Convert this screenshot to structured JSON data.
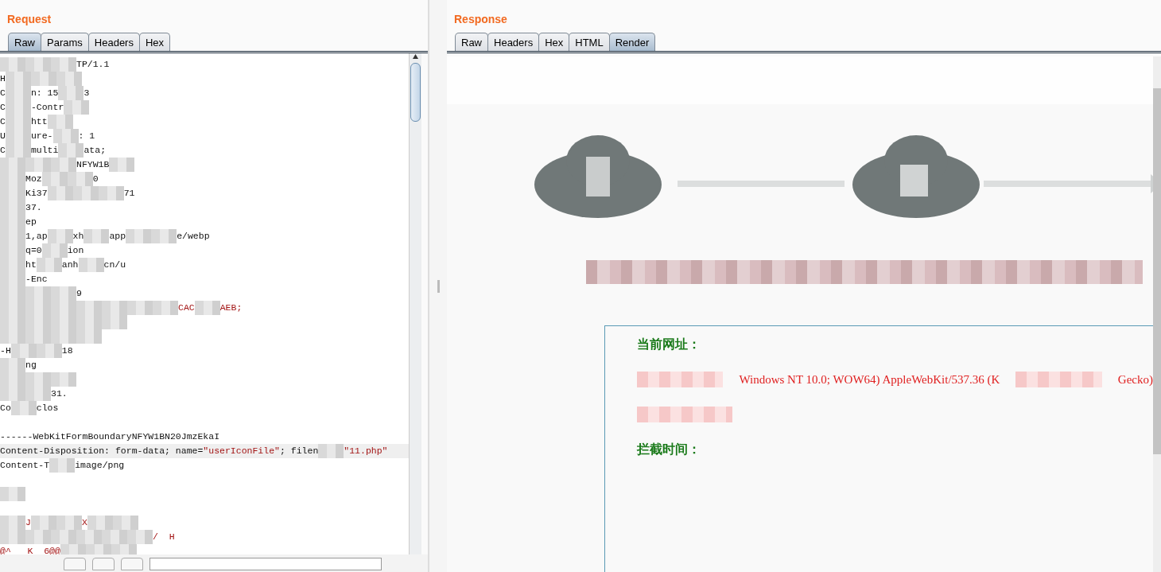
{
  "request": {
    "title": "Request",
    "tabs": [
      {
        "label": "Raw",
        "selected": true
      },
      {
        "label": "Params",
        "selected": false
      },
      {
        "label": "Headers",
        "selected": false
      },
      {
        "label": "Hex",
        "selected": false
      }
    ],
    "lines": [
      {
        "highlighted": false,
        "segments": [
          {
            "kind": "redacted"
          },
          {
            "kind": "redacted"
          },
          {
            "kind": "redacted"
          },
          {
            "kind": "plain",
            "text": "TP/1.1"
          }
        ]
      },
      {
        "highlighted": false,
        "segments": [
          {
            "kind": "plain",
            "text": "H"
          },
          {
            "kind": "redacted"
          },
          {
            "kind": "redacted"
          },
          {
            "kind": "redacted"
          }
        ]
      },
      {
        "highlighted": false,
        "segments": [
          {
            "kind": "plain",
            "text": "C"
          },
          {
            "kind": "redacted"
          },
          {
            "kind": "plain",
            "text": "n: 15"
          },
          {
            "kind": "redacted"
          },
          {
            "kind": "plain",
            "text": "3"
          }
        ]
      },
      {
        "highlighted": false,
        "segments": [
          {
            "kind": "plain",
            "text": "C"
          },
          {
            "kind": "redacted"
          },
          {
            "kind": "plain",
            "text": "-Contr"
          },
          {
            "kind": "redacted"
          }
        ]
      },
      {
        "highlighted": false,
        "segments": [
          {
            "kind": "plain",
            "text": "C"
          },
          {
            "kind": "redacted"
          },
          {
            "kind": "plain",
            "text": "htt"
          },
          {
            "kind": "redacted"
          }
        ]
      },
      {
        "highlighted": false,
        "segments": [
          {
            "kind": "plain",
            "text": "U"
          },
          {
            "kind": "redacted"
          },
          {
            "kind": "plain",
            "text": "ure-"
          },
          {
            "kind": "redacted"
          },
          {
            "kind": "plain",
            "text": ": 1"
          }
        ]
      },
      {
        "highlighted": false,
        "segments": [
          {
            "kind": "plain",
            "text": "C"
          },
          {
            "kind": "redacted"
          },
          {
            "kind": "plain",
            "text": "multi"
          },
          {
            "kind": "redacted"
          },
          {
            "kind": "plain",
            "text": "ata;"
          }
        ]
      },
      {
        "highlighted": false,
        "segments": [
          {
            "kind": "redacted"
          },
          {
            "kind": "redacted"
          },
          {
            "kind": "redacted"
          },
          {
            "kind": "plain",
            "text": "NFYW1B"
          },
          {
            "kind": "redacted"
          }
        ]
      },
      {
        "highlighted": false,
        "segments": [
          {
            "kind": "redacted"
          },
          {
            "kind": "plain",
            "text": "Moz"
          },
          {
            "kind": "redacted"
          },
          {
            "kind": "redacted"
          },
          {
            "kind": "plain",
            "text": "0"
          }
        ]
      },
      {
        "highlighted": false,
        "segments": [
          {
            "kind": "redacted"
          },
          {
            "kind": "plain",
            "text": "Ki"
          },
          {
            "kind": "plain",
            "text": "37"
          },
          {
            "kind": "redacted"
          },
          {
            "kind": "redacted"
          },
          {
            "kind": "redacted"
          },
          {
            "kind": "plain",
            "text": "71"
          }
        ]
      },
      {
        "highlighted": false,
        "segments": [
          {
            "kind": "redacted"
          },
          {
            "kind": "plain",
            "text": "37."
          }
        ]
      },
      {
        "highlighted": false,
        "segments": [
          {
            "kind": "redacted"
          },
          {
            "kind": "plain",
            "text": "ep"
          }
        ]
      },
      {
        "highlighted": false,
        "segments": [
          {
            "kind": "redacted"
          },
          {
            "kind": "plain",
            "text": "1,ap"
          },
          {
            "kind": "redacted"
          },
          {
            "kind": "plain",
            "text": "xh"
          },
          {
            "kind": "redacted"
          },
          {
            "kind": "plain",
            "text": "app"
          },
          {
            "kind": "redacted"
          },
          {
            "kind": "redacted"
          },
          {
            "kind": "plain",
            "text": "e/webp"
          }
        ]
      },
      {
        "highlighted": false,
        "segments": [
          {
            "kind": "redacted"
          },
          {
            "kind": "plain",
            "text": "q=0"
          },
          {
            "kind": "redacted"
          },
          {
            "kind": "plain",
            "text": "ion"
          }
        ]
      },
      {
        "highlighted": false,
        "segments": [
          {
            "kind": "redacted"
          },
          {
            "kind": "plain",
            "text": "ht"
          },
          {
            "kind": "redacted"
          },
          {
            "kind": "plain",
            "text": "anh"
          },
          {
            "kind": "redacted"
          },
          {
            "kind": "plain",
            "text": "cn/u"
          }
        ]
      },
      {
        "highlighted": false,
        "segments": [
          {
            "kind": "redacted"
          },
          {
            "kind": "plain",
            "text": "-Enc"
          }
        ]
      },
      {
        "highlighted": false,
        "segments": [
          {
            "kind": "redacted"
          },
          {
            "kind": "redacted"
          },
          {
            "kind": "redacted"
          },
          {
            "kind": "plain",
            "text": "9"
          }
        ]
      },
      {
        "highlighted": false,
        "segments": [
          {
            "kind": "redacted"
          },
          {
            "kind": "redacted"
          },
          {
            "kind": "redacted"
          },
          {
            "kind": "redacted"
          },
          {
            "kind": "redacted"
          },
          {
            "kind": "redacted"
          },
          {
            "kind": "redacted"
          },
          {
            "kind": "value",
            "text": "CAC"
          },
          {
            "kind": "redacted"
          },
          {
            "kind": "value",
            "text": "AEB;"
          }
        ]
      },
      {
        "highlighted": false,
        "segments": [
          {
            "kind": "redacted"
          },
          {
            "kind": "redacted"
          },
          {
            "kind": "redacted"
          },
          {
            "kind": "redacted"
          },
          {
            "kind": "redacted"
          }
        ]
      },
      {
        "highlighted": false,
        "segments": [
          {
            "kind": "redacted"
          },
          {
            "kind": "redacted"
          },
          {
            "kind": "redacted"
          },
          {
            "kind": "redacted"
          }
        ]
      },
      {
        "highlighted": false,
        "segments": [
          {
            "kind": "plain",
            "text": "-H"
          },
          {
            "kind": "redacted"
          },
          {
            "kind": "redacted"
          },
          {
            "kind": "plain",
            "text": "18"
          }
        ]
      },
      {
        "highlighted": false,
        "segments": [
          {
            "kind": "redacted"
          },
          {
            "kind": "plain",
            "text": "ng"
          }
        ]
      },
      {
        "highlighted": false,
        "segments": [
          {
            "kind": "redacted"
          },
          {
            "kind": "redacted"
          },
          {
            "kind": "redacted"
          }
        ]
      },
      {
        "highlighted": false,
        "segments": [
          {
            "kind": "redacted"
          },
          {
            "kind": "redacted"
          },
          {
            "kind": "plain",
            "text": "31."
          }
        ]
      },
      {
        "highlighted": false,
        "segments": [
          {
            "kind": "plain",
            "text": "Co"
          },
          {
            "kind": "redacted"
          },
          {
            "kind": "plain",
            "text": "clos"
          }
        ]
      },
      {
        "highlighted": false
      },
      {
        "highlighted": false,
        "segments": [
          {
            "kind": "plain",
            "text": "------WebKitFormBoundaryNFYW1BN20JmzEkaI"
          }
        ]
      },
      {
        "highlighted": true,
        "segments": [
          {
            "kind": "plain",
            "text": "Content-Disposition: form-data; name="
          },
          {
            "kind": "value",
            "text": "\"userIconFile\""
          },
          {
            "kind": "plain",
            "text": "; filen"
          },
          {
            "kind": "redacted"
          },
          {
            "kind": "value",
            "text": "\"11.php\""
          }
        ]
      },
      {
        "highlighted": false,
        "segments": [
          {
            "kind": "plain",
            "text": "Content-T"
          },
          {
            "kind": "redacted"
          },
          {
            "kind": "plain",
            "text": "image/png"
          }
        ]
      },
      {
        "highlighted": false
      },
      {
        "highlighted": false,
        "segments": [
          {
            "kind": "redacted"
          }
        ]
      },
      {
        "highlighted": false
      },
      {
        "highlighted": false,
        "segments": [
          {
            "kind": "redacted"
          },
          {
            "kind": "value",
            "text": "J"
          },
          {
            "kind": "redacted"
          },
          {
            "kind": "redacted"
          },
          {
            "kind": "value",
            "text": "X"
          },
          {
            "kind": "redacted"
          },
          {
            "kind": "redacted"
          }
        ]
      },
      {
        "highlighted": false,
        "segments": [
          {
            "kind": "redacted"
          },
          {
            "kind": "redacted"
          },
          {
            "kind": "redacted"
          },
          {
            "kind": "redacted"
          },
          {
            "kind": "redacted"
          },
          {
            "kind": "redacted"
          },
          {
            "kind": "value",
            "text": "/  H"
          }
        ]
      },
      {
        "highlighted": false,
        "segments": [
          {
            "kind": "value",
            "text": "@^   K  6@@"
          },
          {
            "kind": "redacted"
          },
          {
            "kind": "redacted"
          },
          {
            "kind": "redacted"
          }
        ]
      }
    ]
  },
  "response": {
    "title": "Response",
    "tabs": [
      {
        "label": "Raw",
        "selected": false
      },
      {
        "label": "Headers",
        "selected": false
      },
      {
        "label": "Hex",
        "selected": false
      },
      {
        "label": "HTML",
        "selected": false
      },
      {
        "label": "Render",
        "selected": true
      }
    ],
    "render": {
      "fields": [
        {
          "kind": "label",
          "text": "当前网址："
        },
        {
          "kind": "value",
          "parts": [
            "Windows NT 10.0; WOW64) AppleWebKit/537.36 (K",
            "Gecko)"
          ]
        },
        {
          "kind": "redacted"
        },
        {
          "kind": "label",
          "text": "拦截时间："
        }
      ]
    }
  }
}
